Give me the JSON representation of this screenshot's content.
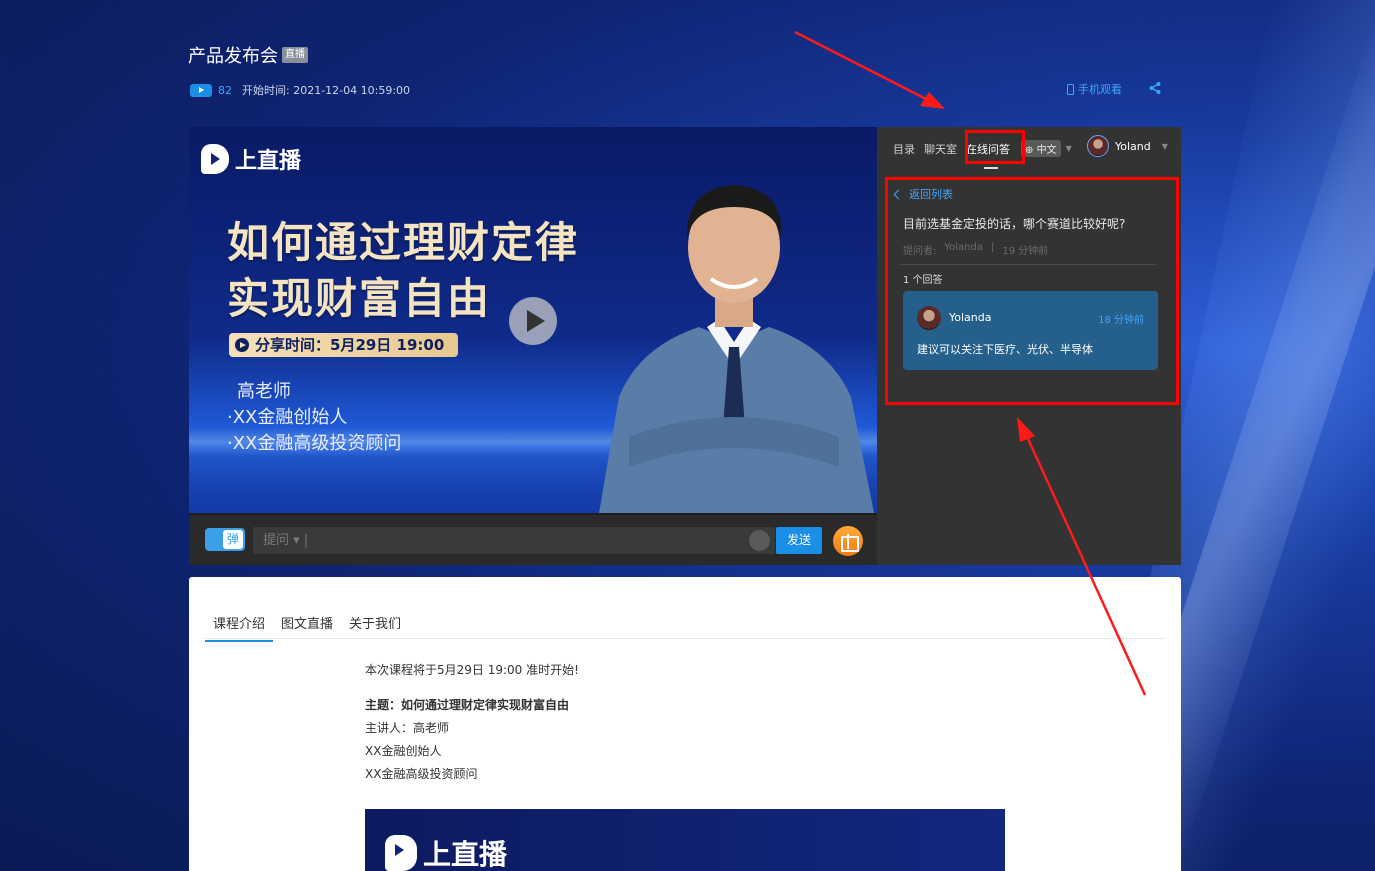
{
  "page": {
    "title": "产品发布会",
    "live_badge": "直播",
    "view_count": "82",
    "start_time": "开始时间: 2021-12-04 10:59:00",
    "mobile_watch": "手机观看"
  },
  "player": {
    "logo_text": "上直播",
    "headline_line1": "如何通过理财定律",
    "headline_line2": "实现财富自由",
    "share_time": "分享时间：5月29日 19:00",
    "teacher_name": "高老师",
    "teacher_title1": "·XX金融创始人",
    "teacher_title2": "·XX金融高级投资顾问"
  },
  "player_bar": {
    "danmu_label": "弹",
    "ask_placeholder": "提问 ▾ |",
    "send_label": "发送"
  },
  "side_panel": {
    "tabs": [
      "目录",
      "聊天室",
      "在线问答"
    ],
    "lang": "中文",
    "user_name": "Yoland",
    "back_label": "返回列表",
    "question": "目前选基金定投的话，哪个赛道比较好呢?",
    "asker_label": "提问者:",
    "asker_name": "Yolanda",
    "asker_sep": "|",
    "asked_time": "19 分钟前",
    "answer_count": "1 个回答",
    "answer": {
      "name": "Yolanda",
      "time": "18 分钟前",
      "text": "建议可以关注下医疗、光伏、半导体"
    }
  },
  "content": {
    "tabs": [
      "课程介绍",
      "图文直播",
      "关于我们"
    ],
    "intro_line1": "本次课程将于5月29日 19:00 准时开始!",
    "topic": "主题：如何通过理财定律实现财富自由",
    "host": "主讲人：高老师",
    "line3": "XX金融创始人",
    "line4": "XX金融高级投资顾问",
    "banner_logo": "上直播"
  },
  "colors": {
    "accent": "#1a8fe8",
    "highlight": "#ff0000",
    "panel_bg": "#333333"
  }
}
